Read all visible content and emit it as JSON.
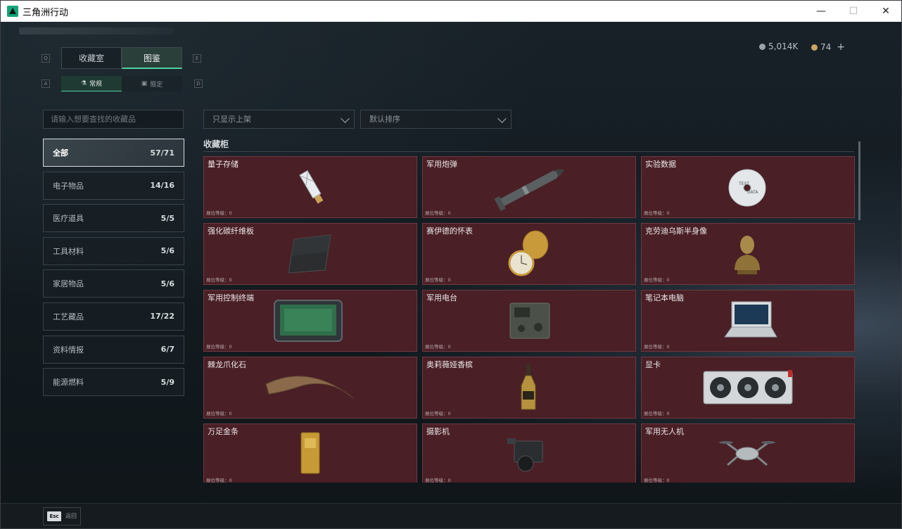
{
  "window": {
    "title": "三角洲行动",
    "minimize_glyph": "—",
    "maximize_glyph": "☐",
    "close_glyph": "✕"
  },
  "currency": {
    "silver": "5,014K",
    "gold": "74",
    "add_glyph": "+"
  },
  "key_hints": {
    "q": "Q",
    "e": "E",
    "a": "A",
    "d": "D"
  },
  "top_tabs": [
    {
      "label": "收藏室",
      "active": false
    },
    {
      "label": "图鉴",
      "active": true
    }
  ],
  "sub_tabs": [
    {
      "label": "常规",
      "icon": "flask-icon",
      "active": true
    },
    {
      "label": "限定",
      "icon": "box-icon",
      "active": false
    }
  ],
  "search": {
    "placeholder": "请输入想要查找的收藏品"
  },
  "filters": {
    "shelf_filter": "只显示上架",
    "sort": "默认排序"
  },
  "categories": [
    {
      "label": "全部",
      "count": "57/71",
      "active": true
    },
    {
      "label": "电子物品",
      "count": "14/16"
    },
    {
      "label": "医疗道具",
      "count": "5/5"
    },
    {
      "label": "工具材料",
      "count": "5/6"
    },
    {
      "label": "家居物品",
      "count": "5/6"
    },
    {
      "label": "工艺藏品",
      "count": "17/22"
    },
    {
      "label": "资料情报",
      "count": "6/7"
    },
    {
      "label": "能源燃料",
      "count": "5/9"
    }
  ],
  "section_title": "收藏柜",
  "items": [
    {
      "name": "量子存储",
      "level": "展位等级：0",
      "icon": "usb-drive-icon"
    },
    {
      "name": "军用炮弹",
      "level": "展位等级：0",
      "icon": "missile-icon"
    },
    {
      "name": "实验数据",
      "level": "展位等级：0",
      "icon": "disc-icon"
    },
    {
      "name": "强化碳纤维板",
      "level": "展位等级：0",
      "icon": "carbon-plate-icon"
    },
    {
      "name": "赛伊德的怀表",
      "level": "展位等级：0",
      "icon": "pocket-watch-icon"
    },
    {
      "name": "克劳迪乌斯半身像",
      "level": "展位等级：0",
      "icon": "bust-icon"
    },
    {
      "name": "军用控制终端",
      "level": "展位等级：0",
      "icon": "terminal-icon"
    },
    {
      "name": "军用电台",
      "level": "展位等级：0",
      "icon": "radio-icon"
    },
    {
      "name": "笔记本电脑",
      "level": "展位等级：0",
      "icon": "laptop-icon"
    },
    {
      "name": "棘龙爪化石",
      "level": "展位等级：0",
      "icon": "claw-fossil-icon"
    },
    {
      "name": "奥莉薇娅香槟",
      "level": "展位等级：0",
      "icon": "champagne-icon"
    },
    {
      "name": "显卡",
      "level": "展位等级：0",
      "icon": "gpu-icon"
    },
    {
      "name": "万足金条",
      "level": "展位等级：0",
      "icon": "gold-bar-icon"
    },
    {
      "name": "摄影机",
      "level": "展位等级：0",
      "icon": "camera-icon"
    },
    {
      "name": "军用无人机",
      "level": "展位等级：0",
      "icon": "drone-icon"
    }
  ],
  "footer": {
    "esc_key": "Esc",
    "back_label": "返回"
  },
  "colors": {
    "accent": "#4fd3a0",
    "card_bg": "#4a1f26",
    "card_border": "#6e3a41"
  }
}
